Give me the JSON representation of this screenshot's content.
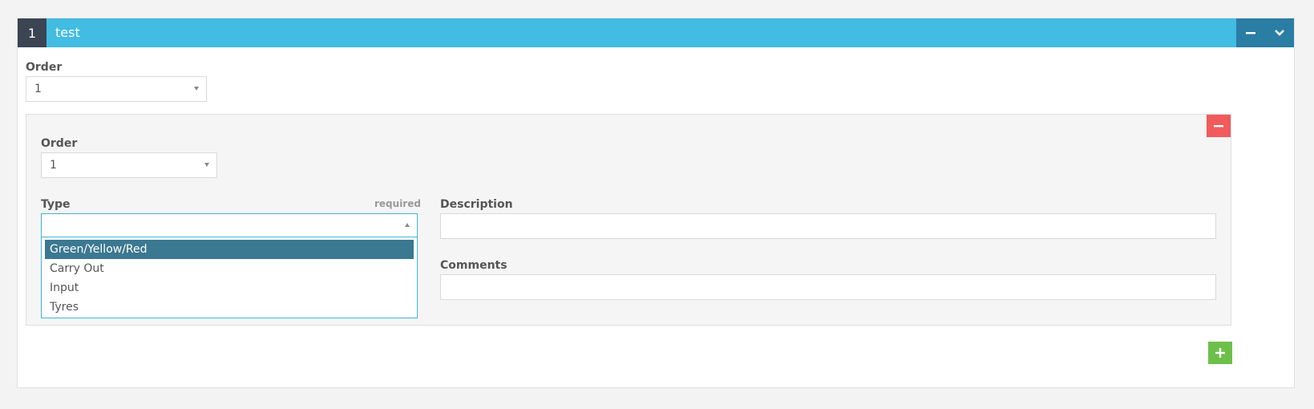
{
  "panel": {
    "index": "1",
    "title": "test",
    "order_label": "Order",
    "order_value": "1"
  },
  "item": {
    "order_label": "Order",
    "order_value": "1",
    "type_label": "Type",
    "required_text": "required",
    "type_value": "",
    "type_options": [
      "Green/Yellow/Red",
      "Carry Out",
      "Input",
      "Tyres"
    ],
    "description_label": "Description",
    "description_value": "",
    "comments_label": "Comments",
    "comments_value": ""
  },
  "colors": {
    "header": "#42bce2",
    "index_bg": "#3b4453",
    "header_buttons": "#2a7da3",
    "remove": "#f15b5b",
    "add": "#6cc04a",
    "active_option": "#3b7891"
  }
}
